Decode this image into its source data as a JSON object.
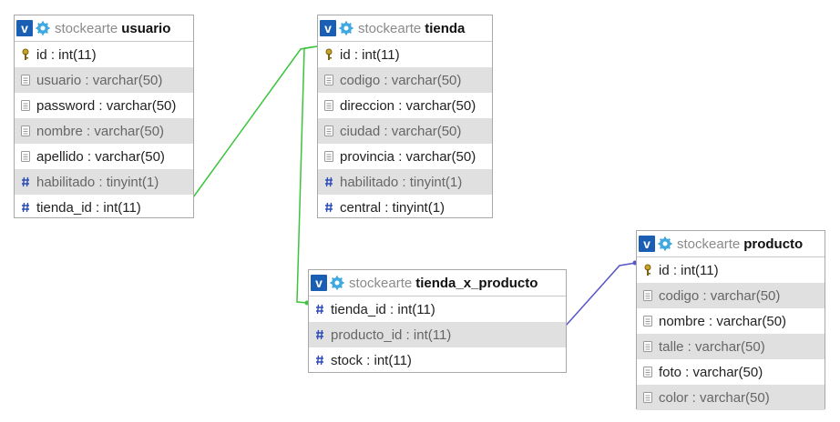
{
  "schema": "stockearte",
  "colors": {
    "fk_green": "#3cc43c",
    "fk_blue": "#5656c8",
    "header_blue": "#1a5fb4"
  },
  "tables": {
    "usuario": {
      "name": "usuario",
      "columns": [
        {
          "label": "id : int(11)",
          "icon": "key-icon"
        },
        {
          "label": "usuario : varchar(50)",
          "icon": "text-field-icon"
        },
        {
          "label": "password : varchar(50)",
          "icon": "text-field-icon"
        },
        {
          "label": "nombre : varchar(50)",
          "icon": "text-field-icon"
        },
        {
          "label": "apellido : varchar(50)",
          "icon": "text-field-icon"
        },
        {
          "label": "habilitado : tinyint(1)",
          "icon": "numeric-field-icon"
        },
        {
          "label": "tienda_id : int(11)",
          "icon": "numeric-field-icon"
        }
      ]
    },
    "tienda": {
      "name": "tienda",
      "columns": [
        {
          "label": "id : int(11)",
          "icon": "key-icon"
        },
        {
          "label": "codigo : varchar(50)",
          "icon": "text-field-icon"
        },
        {
          "label": "direccion : varchar(50)",
          "icon": "text-field-icon"
        },
        {
          "label": "ciudad : varchar(50)",
          "icon": "text-field-icon"
        },
        {
          "label": "provincia : varchar(50)",
          "icon": "text-field-icon"
        },
        {
          "label": "habilitado : tinyint(1)",
          "icon": "numeric-field-icon"
        },
        {
          "label": "central : tinyint(1)",
          "icon": "numeric-field-icon"
        }
      ]
    },
    "tienda_x_producto": {
      "name": "tienda_x_producto",
      "columns": [
        {
          "label": "tienda_id : int(11)",
          "icon": "numeric-field-icon"
        },
        {
          "label": "producto_id : int(11)",
          "icon": "numeric-field-icon"
        },
        {
          "label": "stock : int(11)",
          "icon": "numeric-field-icon"
        }
      ]
    },
    "producto": {
      "name": "producto",
      "columns": [
        {
          "label": "id : int(11)",
          "icon": "key-icon"
        },
        {
          "label": "codigo : varchar(50)",
          "icon": "text-field-icon"
        },
        {
          "label": "nombre : varchar(50)",
          "icon": "text-field-icon"
        },
        {
          "label": "talle : varchar(50)",
          "icon": "text-field-icon"
        },
        {
          "label": "foto : varchar(50)",
          "icon": "text-field-icon"
        },
        {
          "label": "color : varchar(50)",
          "icon": "text-field-icon"
        }
      ]
    }
  },
  "relations": [
    {
      "from": "usuario.tienda_id",
      "to": "tienda.id",
      "color": "#3cc43c"
    },
    {
      "from": "tienda_x_producto.tienda_id",
      "to": "tienda.id",
      "color": "#3cc43c"
    },
    {
      "from": "tienda_x_producto.producto_id",
      "to": "producto.id",
      "color": "#5656c8"
    }
  ]
}
